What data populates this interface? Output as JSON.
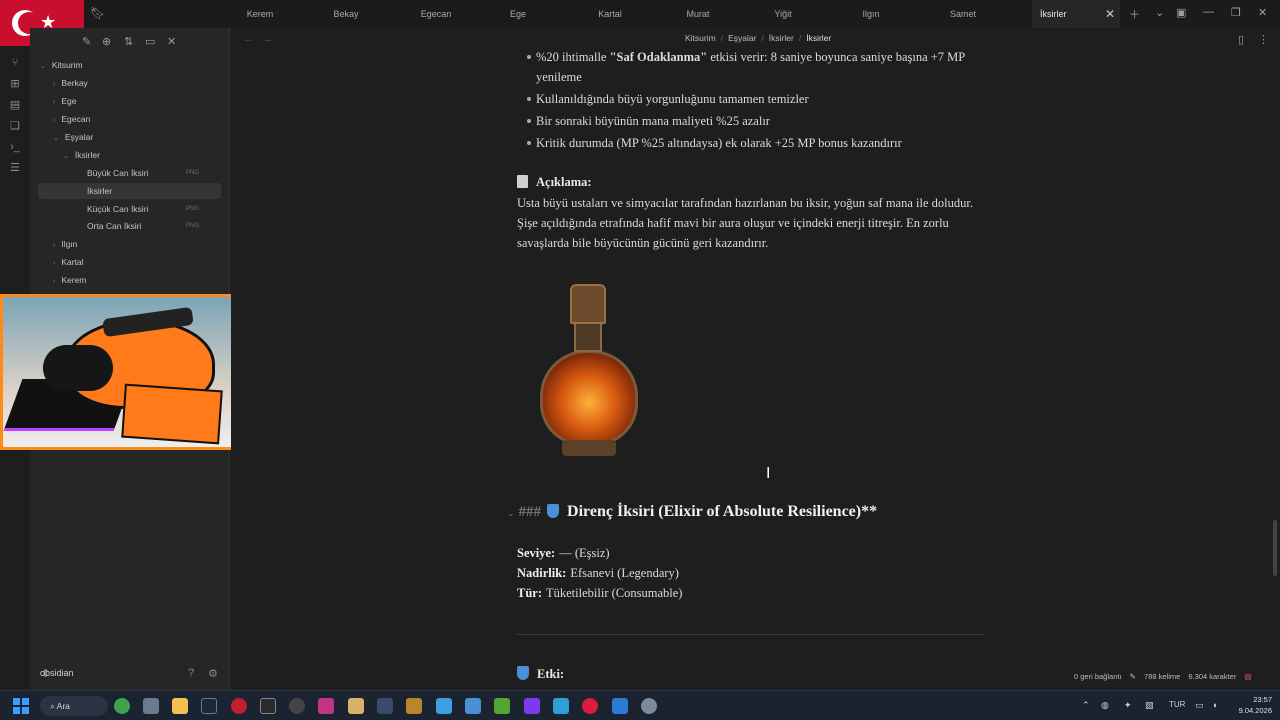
{
  "tabs": [
    "Kerem",
    "Bekay",
    "Egecan",
    "Ege",
    "Kartal",
    "Murat",
    "Yiğit",
    "Ilgın",
    "Samet",
    "İksirler"
  ],
  "active_tab": "İksirler",
  "sidebar": {
    "vault_root": "Kitsurim",
    "items": {
      "berkay": "Berkay",
      "ege": "Ege",
      "egecan": "Egecan",
      "esyalar": "Eşyalar",
      "iksirler_folder": "İksirler",
      "buyuk_can": "Büyük Can İksiri",
      "iksirler_file": "İksirler",
      "kucuk_can": "Küçük Can İksiri",
      "orta_can": "Orta Can İksiri",
      "ilgin": "Ilgın",
      "kartal": "Kartal",
      "kerem": "Kerem"
    },
    "png_badge": "PNG",
    "vault_name": "obsidian"
  },
  "breadcrumb": {
    "parts": [
      "Kitsurim",
      "Eşyalar",
      "İksirler"
    ],
    "current": "İksirler"
  },
  "document": {
    "bullets": [
      {
        "pre": "%20 ihtimalle ",
        "bold": "\"Saf Odaklanma\"",
        "post": " etkisi verir: 8 saniye boyunca saniye başına +7 MP yenileme"
      },
      {
        "pre": "Kullanıldığında büyü yorgunluğunu tamamen temizler"
      },
      {
        "pre": "Bir sonraki büyünün mana maliyeti %25 azalır"
      },
      {
        "pre": "Kritik durumda (MP %25 altındaysa) ek olarak +25 MP bonus kazandırır"
      }
    ],
    "aciklama_label": "Açıklama:",
    "aciklama_text": "Usta büyü ustaları ve simyacılar tarafından hazırlanan bu iksir, yoğun saf mana ile doludur. Şişe açıldığında etrafında hafif mavi bir aura oluşur ve içindeki enerji titreşir. En zorlu savaşlarda bile büyücünün gücünü geri kazandırır.",
    "heading_hashes": "###",
    "heading_title": "Direnç İksiri (Elixir of Absolute Resilience)**",
    "seviye_label": "Seviye:",
    "seviye_value": "— (Eşsiz)",
    "nadirlik_label": "Nadirlik:",
    "nadirlik_value": "Efsanevi (Legendary)",
    "tur_label": "Tür:",
    "tur_value": "Tüketilebilir (Consumable)",
    "etki_label": "Etki:"
  },
  "status_bar": {
    "backlinks": "0 geri bağlantı",
    "words": "788 kelime",
    "chars": "6.304 karakter"
  },
  "taskbar": {
    "search": "Ara",
    "language": "TUR",
    "time": "23:57",
    "date": "9.04.2026"
  },
  "icons": {
    "flag": "turkey-flag-icon",
    "bookmark": "bookmark-icon",
    "windows": "windows-start-icon"
  },
  "colors": {
    "accent_shield": "#4a90d9",
    "flag_red": "#c8102e",
    "overlay_orange": "#ff8a1a"
  }
}
